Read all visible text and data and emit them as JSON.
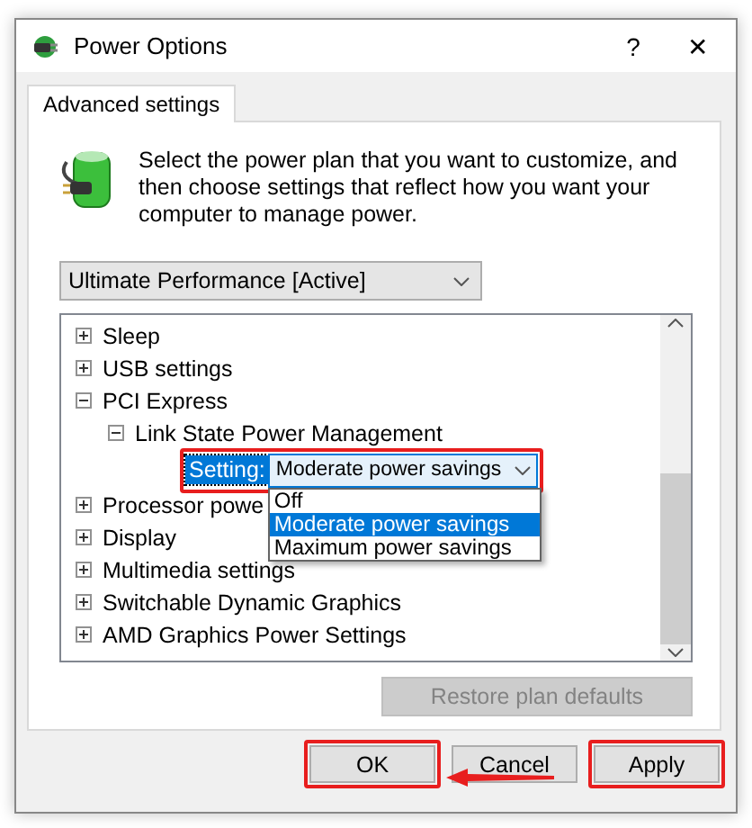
{
  "window": {
    "title": "Power Options",
    "help": "?",
    "close": "✕"
  },
  "tabs": [
    {
      "label": "Advanced settings",
      "selected": true
    }
  ],
  "description": "Select the power plan that you want to customize, and then choose settings that reflect how you want your computer to manage power.",
  "plan": {
    "value": "Ultimate Performance [Active]"
  },
  "tree": [
    {
      "label": "Sleep",
      "expanded": false
    },
    {
      "label": "USB settings",
      "expanded": false
    },
    {
      "label": "PCI Express",
      "expanded": true,
      "children": [
        {
          "label": "Link State Power Management",
          "expanded": true,
          "setting": {
            "label": "Setting:",
            "value": "Moderate power savings",
            "highlighted": true,
            "options": [
              {
                "label": "Off",
                "selected": false
              },
              {
                "label": "Moderate power savings",
                "selected": true
              },
              {
                "label": "Maximum power savings",
                "selected": false
              }
            ]
          }
        }
      ]
    },
    {
      "label": "Processor powe",
      "expanded": false
    },
    {
      "label": "Display",
      "expanded": false
    },
    {
      "label": "Multimedia settings",
      "expanded": false
    },
    {
      "label": "Switchable Dynamic Graphics",
      "expanded": false
    },
    {
      "label": "AMD Graphics Power Settings",
      "expanded": false
    }
  ],
  "restore_button": {
    "label": "Restore plan defaults",
    "disabled": true
  },
  "buttons": [
    {
      "label": "OK",
      "highlighted": true,
      "arrow": false
    },
    {
      "label": "Cancel",
      "highlighted": false,
      "arrow": true
    },
    {
      "label": "Apply",
      "highlighted": true,
      "arrow": false
    }
  ]
}
